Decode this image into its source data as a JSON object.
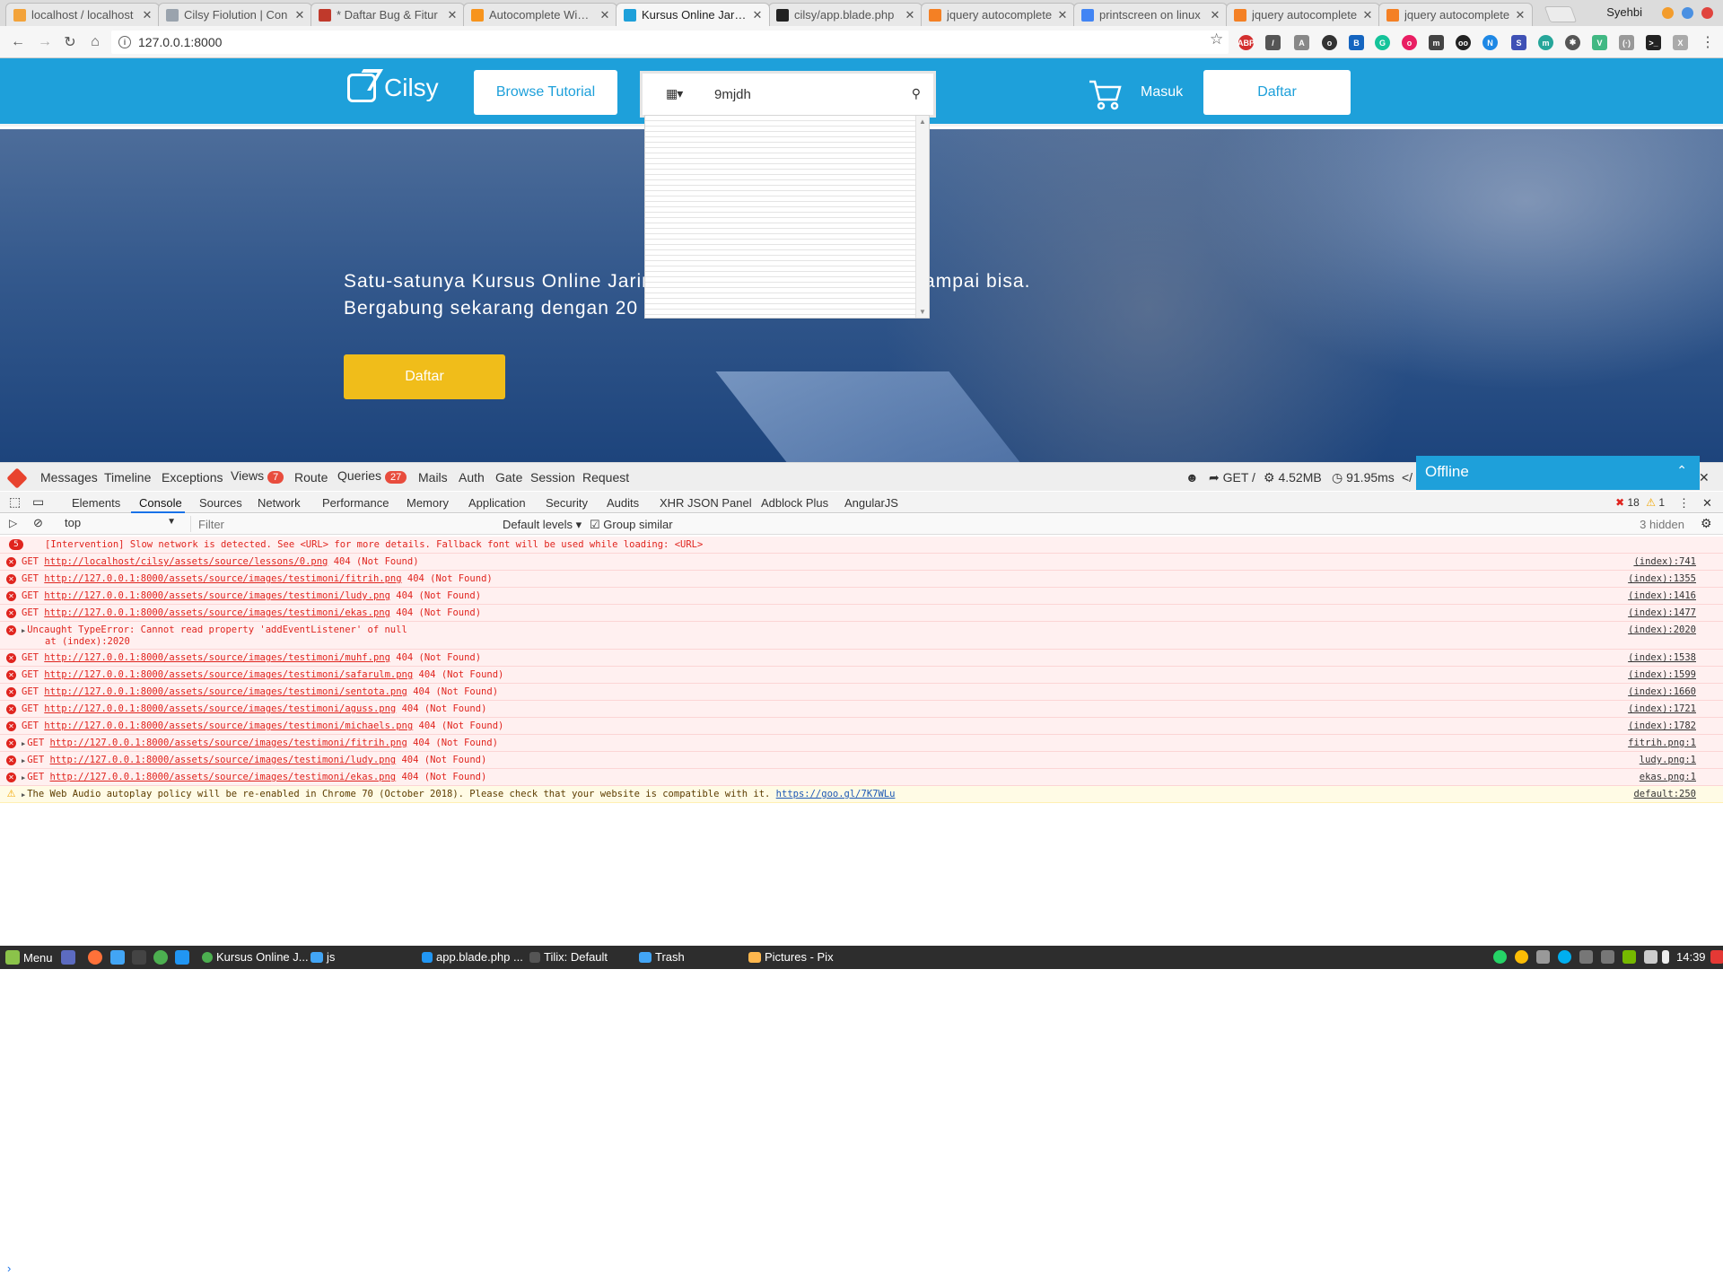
{
  "browser": {
    "tabs": [
      {
        "title": "localhost / localhost",
        "fav_color": "#f3a33a",
        "fav_glyph": "p"
      },
      {
        "title": "Cilsy Fiolution | Con",
        "fav_color": "#9aa3ad",
        "fav_glyph": "C"
      },
      {
        "title": "* Daftar Bug & Fitur",
        "fav_color": "#c0392b",
        "fav_glyph": "T"
      },
      {
        "title": "Autocomplete Widge",
        "fav_color": "#f7941d",
        "fav_glyph": "U"
      },
      {
        "title": "Kursus Online Jaring",
        "fav_color": "#1ea0da",
        "fav_glyph": "C"
      },
      {
        "title": "cilsy/app.blade.php",
        "fav_color": "#222222",
        "fav_glyph": "G"
      },
      {
        "title": "jquery autocomplete",
        "fav_color": "#f48024",
        "fav_glyph": "S"
      },
      {
        "title": "printscreen on linux",
        "fav_color": "#4285f4",
        "fav_glyph": "G"
      },
      {
        "title": "jquery autocomplete",
        "fav_color": "#f48024",
        "fav_glyph": "S"
      },
      {
        "title": "jquery autocomplete",
        "fav_color": "#f48024",
        "fav_glyph": "S"
      }
    ],
    "user_name": "Syehbi",
    "url": "127.0.0.1:8000"
  },
  "site": {
    "logo_text": "Cilsy",
    "browse_label": "Browse Tutorial",
    "search_value": "9mjdh",
    "login_label": "Masuk",
    "register_label": "Daftar",
    "hero_line1": "Satu-satunya Kursus Online Jaring",
    "hero_line1_tail": "sampai bisa.",
    "hero_line2": "Bergabung sekarang dengan 20",
    "hero_button": "Daftar",
    "colors": {
      "brand": "#1ea0da",
      "cta": "#f0bd1a"
    }
  },
  "debugbar": {
    "items": [
      "Messages",
      "Timeline",
      "Exceptions",
      "Views",
      "Route",
      "Queries",
      "Mails",
      "Auth",
      "Gate",
      "Session",
      "Request"
    ],
    "views_count": "7",
    "queries_count": "27",
    "method": "GET /",
    "memory": "4.52MB",
    "time": "91.95ms"
  },
  "chat": {
    "status": "Offline"
  },
  "devtools": {
    "tabs": [
      "Elements",
      "Console",
      "Sources",
      "Network",
      "Performance",
      "Memory",
      "Application",
      "Security",
      "Audits",
      "XHR JSON Panel",
      "Adblock Plus",
      "AngularJS"
    ],
    "error_count": "18",
    "warn_count": "1",
    "context": "top",
    "filter_placeholder": "Filter",
    "levels": "Default levels",
    "group_similar": "Group similar",
    "hidden": "3 hidden",
    "logs": [
      {
        "kind": "error",
        "count": "5",
        "text": "[Intervention] Slow network is detected. See <URL> for more details. Fallback font will be used while loading: <URL>",
        "src": ""
      },
      {
        "kind": "error",
        "prefix": "GET",
        "url": "http://localhost/cilsy/assets/source/lessons/0.png",
        "suffix": "404 (Not Found)",
        "src": "(index):741"
      },
      {
        "kind": "error",
        "prefix": "GET",
        "url": "http://127.0.0.1:8000/assets/source/images/testimoni/fitrih.png",
        "suffix": "404 (Not Found)",
        "src": "(index):1355"
      },
      {
        "kind": "error",
        "prefix": "GET",
        "url": "http://127.0.0.1:8000/assets/source/images/testimoni/ludy.png",
        "suffix": "404 (Not Found)",
        "src": "(index):1416"
      },
      {
        "kind": "error",
        "prefix": "GET",
        "url": "http://127.0.0.1:8000/assets/source/images/testimoni/ekas.png",
        "suffix": "404 (Not Found)",
        "src": "(index):1477"
      },
      {
        "kind": "error",
        "text": "Uncaught TypeError: Cannot read property 'addEventListener' of null",
        "sub": "at (index):2020",
        "src": "(index):2020"
      },
      {
        "kind": "error",
        "prefix": "GET",
        "url": "http://127.0.0.1:8000/assets/source/images/testimoni/muhf.png",
        "suffix": "404 (Not Found)",
        "src": "(index):1538"
      },
      {
        "kind": "error",
        "prefix": "GET",
        "url": "http://127.0.0.1:8000/assets/source/images/testimoni/safarulm.png",
        "suffix": "404 (Not Found)",
        "src": "(index):1599"
      },
      {
        "kind": "error",
        "prefix": "GET",
        "url": "http://127.0.0.1:8000/assets/source/images/testimoni/sentota.png",
        "suffix": "404 (Not Found)",
        "src": "(index):1660"
      },
      {
        "kind": "error",
        "prefix": "GET",
        "url": "http://127.0.0.1:8000/assets/source/images/testimoni/aguss.png",
        "suffix": "404 (Not Found)",
        "src": "(index):1721"
      },
      {
        "kind": "error",
        "prefix": "GET",
        "url": "http://127.0.0.1:8000/assets/source/images/testimoni/michaels.png",
        "suffix": "404 (Not Found)",
        "src": "(index):1782"
      },
      {
        "kind": "error",
        "prefix": "GET",
        "url": "http://127.0.0.1:8000/assets/source/images/testimoni/fitrih.png",
        "suffix": "404 (Not Found)",
        "src": "fitrih.png:1"
      },
      {
        "kind": "error",
        "prefix": "GET",
        "url": "http://127.0.0.1:8000/assets/source/images/testimoni/ludy.png",
        "suffix": "404 (Not Found)",
        "src": "ludy.png:1"
      },
      {
        "kind": "error",
        "prefix": "GET",
        "url": "http://127.0.0.1:8000/assets/source/images/testimoni/ekas.png",
        "suffix": "404 (Not Found)",
        "src": "ekas.png:1"
      },
      {
        "kind": "warn",
        "text": "The Web Audio autoplay policy will be re-enabled in Chrome 70 (October 2018). Please check that your website is compatible with it.",
        "url": "https://goo.gl/7K7WLu",
        "src": "default:250"
      }
    ]
  },
  "taskbar": {
    "menu": "Menu",
    "apps": [
      "Kursus Online J...",
      "js",
      "app.blade.php ...",
      "Tilix: Default",
      "Trash",
      "Pictures - Pix"
    ],
    "clock": "14:39"
  }
}
